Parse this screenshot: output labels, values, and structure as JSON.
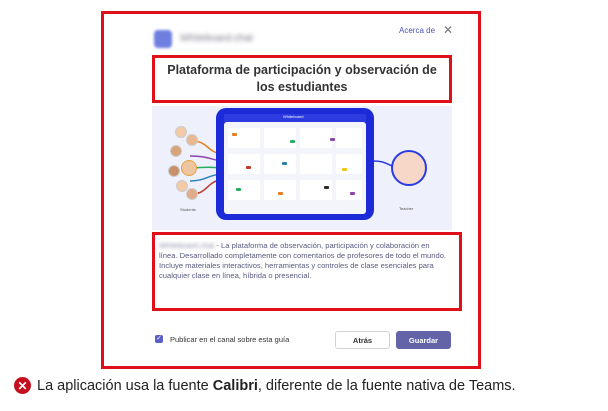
{
  "dialog": {
    "app_name": "Whiteboard.chat",
    "about_link": "Acerca de",
    "close_icon": "close-icon",
    "title": "Plataforma de participación y observación de los estudiantes",
    "illustration": {
      "tablet_brand": "Whiteboard",
      "students_label": "Students",
      "teacher_label": "Teacher"
    },
    "description": {
      "app_name": "Whiteboard.chat",
      "text": " - La plataforma de observación, participación y colaboración en línea. Desarrollado completamente con comentarios de profesores de todo el mundo. Incluye materiales interactivos, herramientas y controles de clase esenciales para cualquier clase en línea, híbrida o presencial."
    },
    "footer": {
      "checkbox_label": "Publicar en el canal sobre esta guía",
      "checkbox_checked": true,
      "back_button": "Atrás",
      "save_button": "Guardar"
    }
  },
  "caption": {
    "icon": "error-icon",
    "text_before": "La aplicación usa la fuente ",
    "text_bold": "Calibri",
    "text_after": ", diferente de la fuente nativa de Teams."
  },
  "colors": {
    "highlight": "#e0101b",
    "accent": "#6264a7",
    "tablet": "#1c2bd7",
    "error": "#c50f1f"
  }
}
